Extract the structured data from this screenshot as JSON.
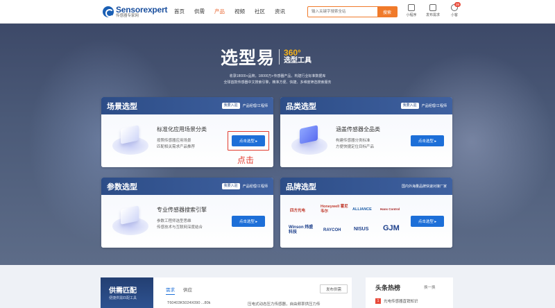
{
  "header": {
    "logo_main": "Sensorexpert",
    "logo_sub": "传感器专家网",
    "nav": [
      "首页",
      "供需",
      "产品",
      "视频",
      "社区",
      "资讯"
    ],
    "active_nav": "产品",
    "search_placeholder": "输入关键字搜索全站",
    "search_button": "搜索",
    "icons": [
      {
        "label": "小程序",
        "icon": "miniprogram-icon"
      },
      {
        "label": "发布需求",
        "icon": "publish-icon"
      },
      {
        "label": "小客",
        "icon": "user-icon",
        "badge": "28"
      }
    ]
  },
  "hero": {
    "title": "选型易",
    "sub_number": "360°",
    "sub_text": "选型工具",
    "desc_line1": "收录18000+品牌，18000万+传感器产品，构建行业标准数据库",
    "desc_line2": "全球首款传感器中文搜索引擎，精准方便、快捷、多维度筛选搜索服务"
  },
  "cards": {
    "scene": {
      "title": "场景选型",
      "pill": "我要入驻",
      "right": "产品经理/工程师",
      "heading": "标准化应用场景分类",
      "line1": "按照传感器应用场景",
      "line2": "匹配相关需求产品推荐",
      "button": "点击选型 ▸"
    },
    "category": {
      "title": "品类选型",
      "pill": "我要入驻",
      "right": "产品经理/工程师",
      "heading": "涵盖传感器全品类",
      "line1": "构建传感器分类标准",
      "line2": "方便快捷定位目标产品",
      "button": "点击选型 ▸"
    },
    "param": {
      "title": "参数选型",
      "pill": "我要入驻",
      "right": "产品经理/工程师",
      "heading": "专业传感器搜索引擎",
      "line1": "参数工程师选型思维",
      "line2": "传感技术与互联网深度结合",
      "button": "点击选型 ▸"
    },
    "brand": {
      "title": "品牌选型",
      "right": "国内外海量品牌快速对接厂家",
      "button": "点击选型 ▸",
      "brands": [
        "四方光电",
        "Honeywell 霍尼韦尔",
        "ALLIANCE",
        "Hans Control",
        "Winson 炜盛科技",
        "RAYCOH",
        "NISUS",
        "GJM"
      ]
    }
  },
  "annotation": "点击",
  "bottom": {
    "supply_title": "供需匹配",
    "supply_sub": "便捷供需匹配工具",
    "tab_demand": "需求",
    "tab_supply": "供应",
    "publish": "发布供需",
    "row_text": "T60403K5024X090 ...80k",
    "row_text2": "压电式动态压力传感器，自由频率供压力传",
    "hot_title": "头条热榜",
    "hot_switch": "换一换",
    "hot_item_num": "1",
    "hot_item": "光电传感器直销知识"
  },
  "colors": {
    "brand_blue": "#1a4f9e",
    "accent_orange": "#f07a2a",
    "button_blue": "#1d6fd8",
    "annotation_red": "#e23b2e"
  }
}
